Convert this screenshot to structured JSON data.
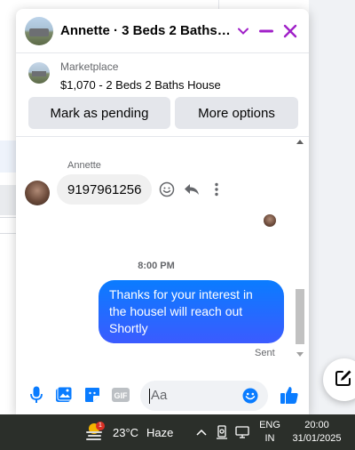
{
  "chat": {
    "title": "Annette · 3 Beds 2 Baths H...",
    "marketplace": {
      "source_label": "Marketplace",
      "listing_title": "$1,070 - 2 Beds 2 Baths House"
    },
    "actions": {
      "mark_pending_label": "Mark as pending",
      "more_options_label": "More options"
    },
    "messages": {
      "incoming_sender": "Annette",
      "incoming_text": "9197961256",
      "timestamp": "8:00 PM",
      "outgoing_text": "Thanks for your interest in the housel will reach out Shortly",
      "outgoing_status": "Sent"
    },
    "composer": {
      "placeholder": "Aa"
    },
    "colors": {
      "accent": "#0a7cff",
      "header_controls": "#a020c8"
    }
  },
  "taskbar": {
    "weather": {
      "temperature": "23°C",
      "condition": "Haze",
      "badge": "1"
    },
    "language": {
      "line1": "ENG",
      "line2": "IN"
    },
    "clock": {
      "time": "20:00",
      "date": "31/01/2025"
    }
  }
}
